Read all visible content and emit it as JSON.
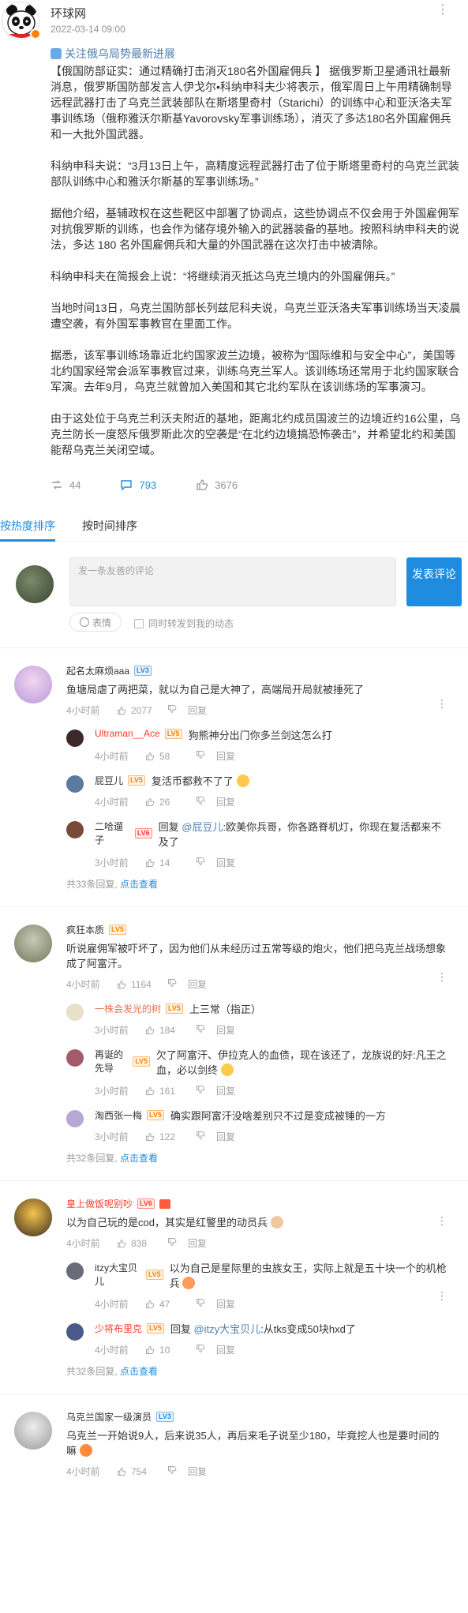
{
  "header": {
    "name": "环球网",
    "time": "2022-03-14 09:00"
  },
  "article": {
    "topic": "关注俄乌局势最新进展",
    "paragraphs": [
      "【俄国防部证实：通过精确打击消灭180名外国雇佣兵 】 据俄罗斯卫星通讯社最新消息，俄罗斯国防部发言人伊戈尔•科纳申科夫少将表示，俄军周日上午用精确制导远程武器打击了乌克兰武装部队在斯塔里奇村（Starichi）的训练中心和亚沃洛夫军事训练场（俄称雅沃尔斯基Yavorovsky军事训练场），消灭了多达180名外国雇佣兵和一大批外国武器。",
      "科纳申科夫说：“3月13日上午，高精度远程武器打击了位于斯塔里奇村的乌克兰武装部队训练中心和雅沃尔斯基的军事训练场。”",
      "据他介绍，基辅政权在这些靶区中部署了协调点，这些协调点不仅会用于外国雇佣军对抗俄罗斯的训练，也会作为储存境外输入的武器装备的基地。按照科纳申科夫的说法，多达 180 名外国雇佣兵和大量的外国武器在这次打击中被清除。",
      "科纳申科夫在简报会上说：“将继续消灭抵达乌克兰境内的外国雇佣兵。”",
      "当地时间13日，乌克兰国防部长列兹尼科夫说，乌克兰亚沃洛夫军事训练场当天凌晨遭空袭，有外国军事教官在里面工作。",
      "据悉，该军事训练场靠近北约国家波兰边境，被称为“国际维和与安全中心”，美国等北约国家经常会派军事教官过来，训练乌克兰军人。该训练场还常用于北约国家联合军演。去年9月，乌克兰就曾加入美国和其它北约军队在该训练场的军事演习。",
      "由于这处位于乌克兰利沃夫附近的基地，距离北约成员国波兰的边境近约16公里，乌克兰防长一度怒斥俄罗斯此次的空袭是“在北约边境搞恐怖袭击”，并希望北约和美国能帮乌克兰关闭空域。"
    ]
  },
  "actions": {
    "repost": "44",
    "comment": "793",
    "like": "3676"
  },
  "tabs": {
    "hot": "按热度排序",
    "time": "按时间排序"
  },
  "composer": {
    "placeholder": "发一条友善的评论",
    "send": "发表评论",
    "emoji": "表情",
    "repost": "同时转发到我的动态"
  },
  "comments": [
    {
      "name": "起名太麻烦aaa",
      "level": "LV3",
      "text": "鱼塘局虐了两把菜，就以为自己是大神了，高端局开局就被捶死了",
      "time": "4小时前",
      "likes": "2077",
      "reply": "回复",
      "replies": [
        {
          "name": "Ultraman__Ace",
          "level": "LV5",
          "text": "狗熊神分出门你多兰剑这怎么打",
          "time": "4小时前",
          "likes": "58",
          "reply": "回复"
        },
        {
          "name": "屁豆儿",
          "level": "LV5",
          "text": "复活币都救不了了",
          "time": "4小时前",
          "likes": "26",
          "reply": "回复"
        },
        {
          "name": "二哈遛子",
          "level": "LV6",
          "prefix": "回复 ",
          "at": "@屁豆儿",
          "text": ":欧美你兵哥，你各路脊机灯，你现在复活都来不及了",
          "time": "3小时前",
          "likes": "14",
          "reply": "回复"
        }
      ],
      "more_count": "共33条回复,",
      "more_link": "点击查看"
    },
    {
      "name": "疯狂本质",
      "level": "LV5",
      "text": "听说雇佣军被吓坏了，因为他们从未经历过五常等级的炮火，他们把乌克兰战场想象成了阿富汗。",
      "time": "4小时前",
      "likes": "1164",
      "reply": "回复",
      "replies": [
        {
          "name": "一株会发光的树",
          "level": "LV5",
          "text": "上三常（指正）",
          "time": "3小时前",
          "likes": "184",
          "reply": "回复"
        },
        {
          "name": "再诞的先导",
          "level": "LV5",
          "text": "欠了阿富汗、伊拉克人的血债，现在该还了，龙族说的好:凡王之血，必以剑终",
          "time": "3小时前",
          "likes": "161",
          "reply": "回复"
        },
        {
          "name": "淘西张一梅",
          "level": "LV5",
          "text": "确实跟阿富汗没啥差别只不过是变成被锤的一方",
          "time": "3小时前",
          "likes": "122",
          "reply": "回复"
        }
      ],
      "more_count": "共32条回复,",
      "more_link": "点击查看"
    },
    {
      "name": "皇上做饭呢别吵",
      "level": "LV6",
      "text": "以为自己玩的是cod，其实是红警里的动员兵",
      "time": "4小时前",
      "likes": "838",
      "reply": "回复",
      "replies": [
        {
          "name": "itzy大宝贝儿",
          "level": "LV5",
          "text": "以为自己是星际里的虫族女王，实际上就是五十块一个的机枪兵",
          "time": "4小时前",
          "likes": "47",
          "reply": "回复"
        },
        {
          "name": "少将布里克",
          "level": "LV5",
          "prefix": "回复 ",
          "at": "@itzy大宝贝儿",
          "text": ":从tks变成50块hxd了",
          "time": "4小时前",
          "likes": "10",
          "reply": "回复"
        }
      ],
      "more_count": "共32条回复,",
      "more_link": "点击查看"
    },
    {
      "name": "乌克兰国家一级演员",
      "level": "LV3",
      "text": "乌克兰一开始说9人，后来说35人，再后来毛子说至少180，毕竟挖人也是要时间的嘛",
      "time": "4小时前",
      "likes": "754",
      "reply": "回复",
      "replies": []
    }
  ],
  "colors": {
    "accent": "#1f8ce0",
    "link": "#507daf",
    "vip_red": "#ff3c2a",
    "vip_orange": "#eb7350"
  }
}
